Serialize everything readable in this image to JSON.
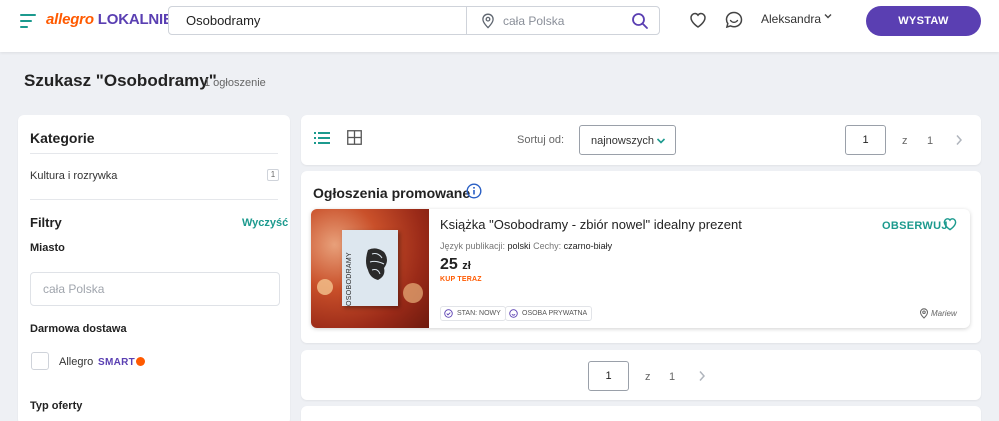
{
  "header": {
    "logo_part1": "allegro",
    "logo_part2": "LOKALNIE",
    "search_value": "Osobodramy",
    "location_placeholder": "cała Polska",
    "user_name": "Aleksandra",
    "cta_label": "WYSTAW",
    "icons": [
      "menu-icon",
      "location-pin-icon",
      "search-icon",
      "heart-icon",
      "chat-icon",
      "chevron-down-icon"
    ]
  },
  "page": {
    "title": "Szukasz \"Osobodramy\"",
    "count": "1 ogłoszenie"
  },
  "sidebar": {
    "categories_heading": "Kategorie",
    "categories": [
      {
        "label": "Kultura i rozrywka",
        "count": "1"
      }
    ],
    "filters_heading": "Filtry",
    "clear_label": "Wyczyść",
    "city_label": "Miasto",
    "city_placeholder": "cała Polska",
    "free_shipping_label": "Darmowa dostawa",
    "allegro_label": "Allegro",
    "smart_label": "SMART",
    "offer_type_label": "Typ oferty"
  },
  "toolbar": {
    "sort_label": "Sortuj od:",
    "sort_value": "najnowszych",
    "page_current": "1",
    "page_of": "z",
    "page_total": "1"
  },
  "promoted": {
    "heading": "Ogłoszenia promowane",
    "items": [
      {
        "title": "Książka \"Osobodramy - zbiór nowel\" idealny prezent",
        "observe_label": "OBSERWUJ",
        "lang_label": "Język publikacji:",
        "lang_value": "polski",
        "features_label": "Cechy:",
        "features_value": "czarno-biały",
        "price": "25",
        "currency": "zł",
        "buy_label": "KUP TERAZ",
        "tags": [
          "STAN: NOWY",
          "OSOBA PRYWATNA"
        ],
        "location": "Mariew",
        "book_cover_title": "OSOBODRAMY"
      }
    ]
  },
  "pagination_bottom": {
    "page_current": "1",
    "page_of": "z",
    "page_total": "1"
  },
  "colors": {
    "brand_orange": "#ff5a00",
    "brand_purple": "#5a3fb2",
    "accent_teal": "#1c9a8e",
    "background": "#eef0f4"
  }
}
